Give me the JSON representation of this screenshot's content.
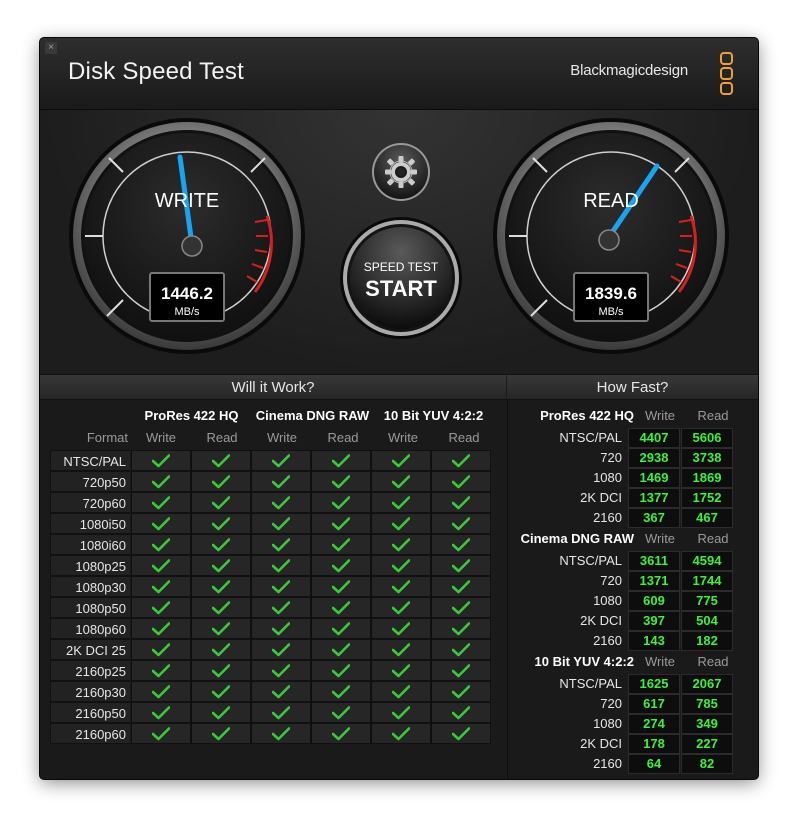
{
  "window": {
    "title": "Disk Speed Test",
    "close_glyph": "×"
  },
  "brand": {
    "name": "Blackmagicdesign",
    "logo_icon": "blackmagic-logo-icon",
    "logo_color": "#f0a030"
  },
  "gauges": {
    "write": {
      "label": "WRITE",
      "value": "1446.2",
      "unit": "MB/s",
      "needle_color": "#1aa4f0"
    },
    "read": {
      "label": "READ",
      "value": "1839.6",
      "unit": "MB/s",
      "needle_color": "#1aa4f0"
    }
  },
  "controls": {
    "settings_icon": "gear-icon",
    "start_small": "SPEED TEST",
    "start_big": "START"
  },
  "will_it_work": {
    "title": "Will it Work?",
    "format_header": "Format",
    "codecs": [
      "ProRes 422 HQ",
      "Cinema DNG RAW",
      "10 Bit YUV 4:2:2"
    ],
    "sub_headers": [
      "Write",
      "Read"
    ],
    "formats": [
      "NTSC/PAL",
      "720p50",
      "720p60",
      "1080i50",
      "1080i60",
      "1080p25",
      "1080p30",
      "1080p50",
      "1080p60",
      "2K DCI 25",
      "2160p25",
      "2160p30",
      "2160p50",
      "2160p60"
    ],
    "check_color": "#3cc83c"
  },
  "how_fast": {
    "title": "How Fast?",
    "col_write": "Write",
    "col_read": "Read",
    "sections": [
      {
        "title": "ProRes 422 HQ",
        "rows": [
          {
            "label": "NTSC/PAL",
            "write": "4407",
            "read": "5606"
          },
          {
            "label": "720",
            "write": "2938",
            "read": "3738"
          },
          {
            "label": "1080",
            "write": "1469",
            "read": "1869"
          },
          {
            "label": "2K DCI",
            "write": "1377",
            "read": "1752"
          },
          {
            "label": "2160",
            "write": "367",
            "read": "467"
          }
        ]
      },
      {
        "title": "Cinema DNG RAW",
        "rows": [
          {
            "label": "NTSC/PAL",
            "write": "3611",
            "read": "4594"
          },
          {
            "label": "720",
            "write": "1371",
            "read": "1744"
          },
          {
            "label": "1080",
            "write": "609",
            "read": "775"
          },
          {
            "label": "2K DCI",
            "write": "397",
            "read": "504"
          },
          {
            "label": "2160",
            "write": "143",
            "read": "182"
          }
        ]
      },
      {
        "title": "10 Bit YUV 4:2:2",
        "rows": [
          {
            "label": "NTSC/PAL",
            "write": "1625",
            "read": "2067"
          },
          {
            "label": "720",
            "write": "617",
            "read": "785"
          },
          {
            "label": "1080",
            "write": "274",
            "read": "349"
          },
          {
            "label": "2K DCI",
            "write": "178",
            "read": "227"
          },
          {
            "label": "2160",
            "write": "64",
            "read": "82"
          }
        ]
      }
    ]
  }
}
